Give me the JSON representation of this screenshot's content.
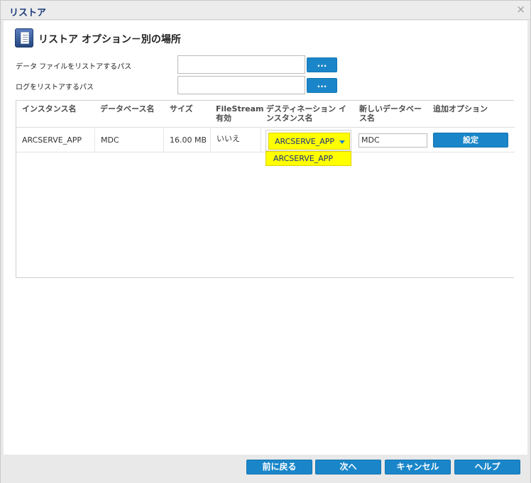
{
  "window": {
    "title": "リストア",
    "close_glyph": "×"
  },
  "header": {
    "title": "リストア オプション－別の場所",
    "icon": "document-pages-icon"
  },
  "paths": {
    "data_label": "データ ファイルをリストアするパス",
    "log_label": "ログをリストアするパス",
    "data_value": "",
    "log_value": "",
    "browse_label": "..."
  },
  "table": {
    "columns": [
      "インスタンス名",
      "データベース名",
      "サイズ",
      "FileStream\n有効",
      "デスティネーション イ\nンスタンス名",
      "新しいデータベー\nス名",
      "追加オプション"
    ],
    "rows": [
      {
        "instance": "ARCSERVE_APP",
        "database": "MDC",
        "size": "16.00 MB",
        "filestream": "いいえ",
        "destination": "ARCSERVE_APP",
        "new_db_name": "MDC",
        "options_button": "設定"
      }
    ],
    "dropdown_options": [
      "ARCSERVE_APP"
    ]
  },
  "footer": {
    "back": "前に戻る",
    "next": "次へ",
    "cancel": "キャンセル",
    "help": "ヘルプ"
  },
  "colors": {
    "accent": "#1a86c9",
    "highlight": "#ffff00",
    "title": "#1a3a7a"
  }
}
